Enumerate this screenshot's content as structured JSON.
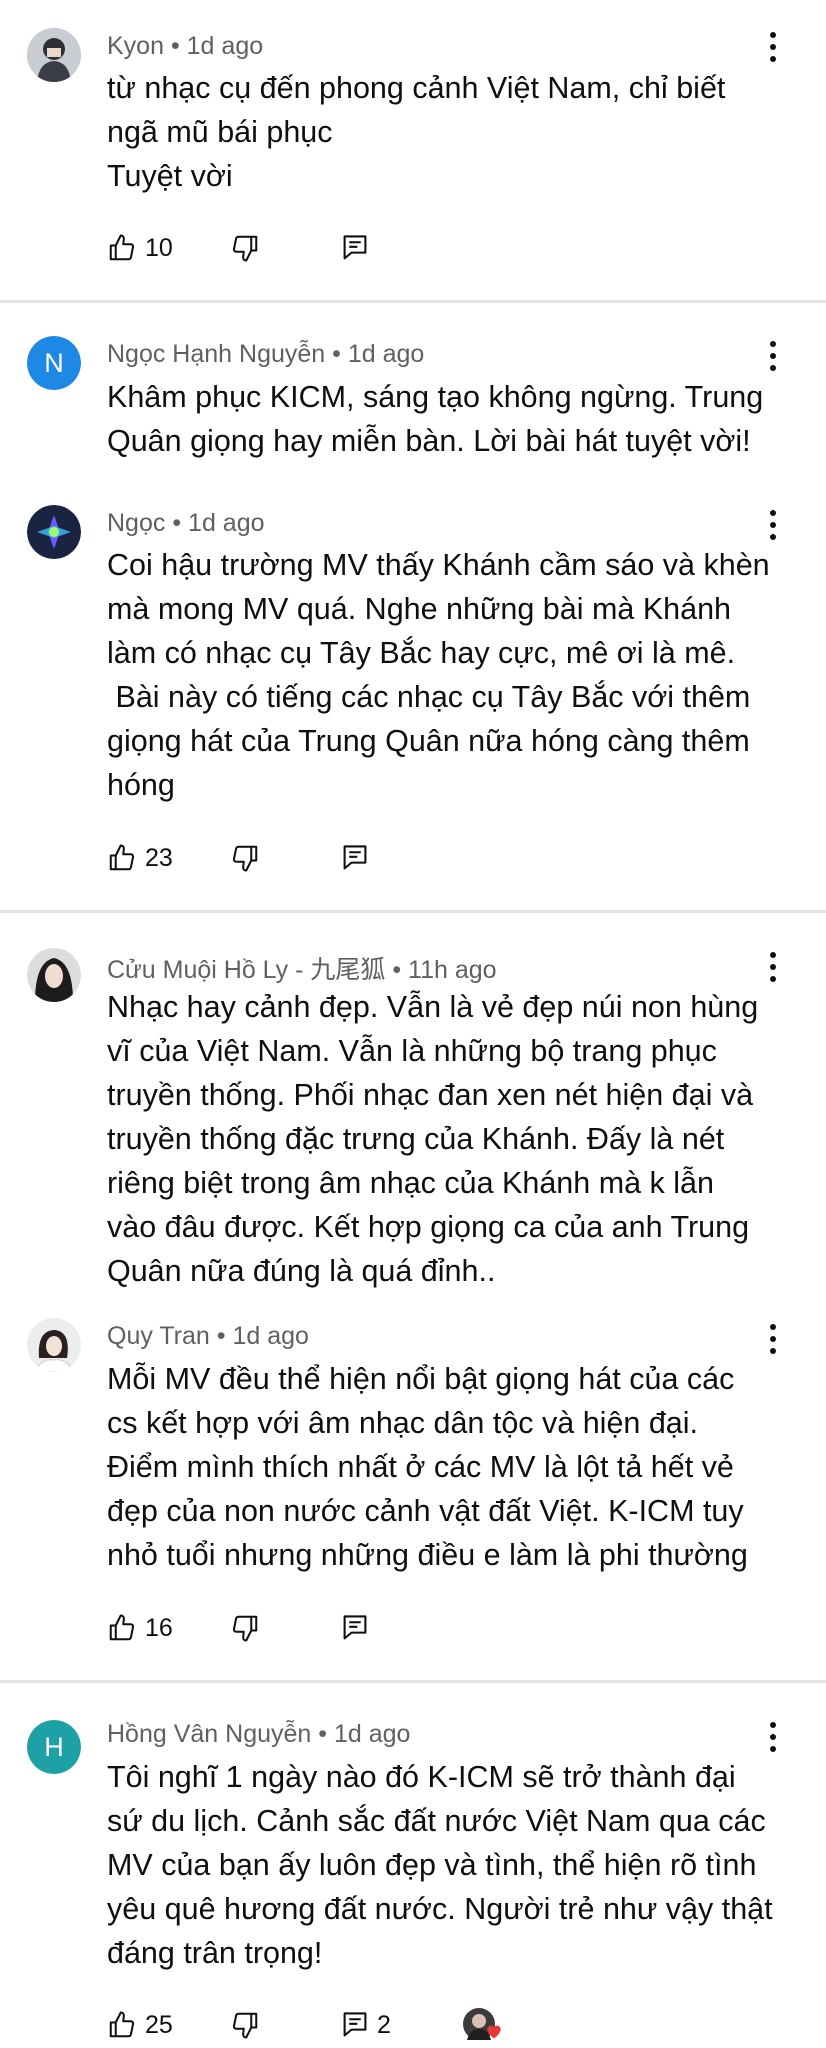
{
  "comments": [
    {
      "author": "Kyon",
      "time": "1d ago",
      "text": "từ nhạc cụ đến phong cảnh Việt Nam, chỉ biết\nngã mũ bái phục\nTuyệt vời",
      "likes": "10"
    },
    {
      "avatar_letter": "N",
      "avatar_color": "#1e88e5",
      "author": "Ngọc Hạnh Nguyễn",
      "time": "1d ago",
      "text": "Khâm phục KICM, sáng tạo không ngừng. Trung\nQuân giọng hay miễn bàn. Lời bài hát tuyệt vời!"
    },
    {
      "author": "Ngọc",
      "time": "1d ago",
      "text": "Coi hậu trường MV thấy Khánh cầm sáo và khèn\nmà mong MV quá. Nghe những bài mà Khánh\nlàm có nhạc cụ Tây Bắc hay cực, mê ơi là mê.\n Bài này có tiếng các nhạc cụ Tây Bắc với thêm\ngiọng hát của Trung Quân nữa hóng càng thêm\nhóng",
      "likes": "23"
    },
    {
      "author": "Cửu Muội Hồ Ly - 九尾狐",
      "time": "11h ago",
      "text": "Nhạc hay cảnh đẹp. Vẫn là vẻ đẹp núi non hùng\nvĩ của Việt Nam. Vẫn là những bộ trang phục\ntruyền thống. Phối nhạc đan xen nét hiện đại và\ntruyền thống đặc trưng của Khánh. Đấy là nét\nriêng biệt trong âm nhạc của Khánh mà k lẫn\nvào đâu được. Kết hợp giọng ca của anh Trung\nQuân nữa đúng là quá đỉnh.."
    },
    {
      "author": "Quy Tran",
      "time": "1d ago",
      "text": "Mỗi MV đều thể hiện nổi bật giọng hát của các\ncs kết hợp với âm nhạc dân tộc và hiện đại.\nĐiểm mình thích nhất ở các MV là lột tả hết vẻ\nđẹp của non nước cảnh vật đất Việt. K-ICM tuy\nnhỏ tuổi nhưng những điều e làm là phi thường",
      "likes": "16"
    },
    {
      "avatar_letter": "H",
      "avatar_color": "#1da1a6",
      "author": "Hồng Vân Nguyễn",
      "time": "1d ago",
      "text": "Tôi nghĩ 1 ngày nào đó K-ICM sẽ trở thành đại\nsứ du lịch. Cảnh sắc đất nước Việt Nam qua các\nMV của bạn ấy luôn đẹp và tình, thể hiện rõ tình\nyêu quê hương đất nước. Người trẻ như vậy thật\nđáng trân trọng!",
      "likes": "25",
      "replies": "2"
    }
  ],
  "separator": "•",
  "icons": {
    "like": "thumb-up-icon",
    "dislike": "thumb-down-icon",
    "reply": "reply-icon",
    "more": "more-vert-icon",
    "heart": "creator-heart-icon"
  },
  "colors": {
    "meta": "#606060",
    "heart": "#e53935",
    "divider": "#e4e4e4"
  }
}
